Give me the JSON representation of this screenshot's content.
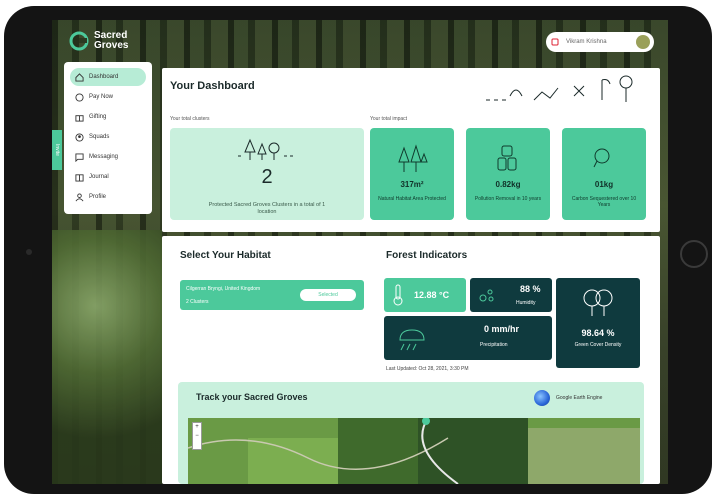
{
  "brand": {
    "name": "Sacred Groves"
  },
  "user": {
    "name": "Vikram Krishna"
  },
  "sidebar": {
    "items": [
      {
        "label": "Dashboard",
        "icon": "home-icon",
        "active": true
      },
      {
        "label": "Pay Now",
        "icon": "coin-icon"
      },
      {
        "label": "Gifting",
        "icon": "gift-icon"
      },
      {
        "label": "Squads",
        "icon": "squad-icon"
      },
      {
        "label": "Messaging",
        "icon": "message-icon"
      },
      {
        "label": "Journal",
        "icon": "journal-icon"
      },
      {
        "label": "Profile",
        "icon": "profile-icon"
      }
    ],
    "side_tab": "Invite"
  },
  "dashboard": {
    "title": "Your Dashboard",
    "clusters_label": "Your total clusters",
    "impact_label": "Your total impact",
    "clusters": {
      "value": "2",
      "description": "Protected Sacred Groves Clusters in a total of 1 location"
    },
    "impact": [
      {
        "value": "317m²",
        "description": "Natural Habitat Area Protected",
        "icon": "trees-icon"
      },
      {
        "value": "0.82kg",
        "description": "Pollution Removal in 10 years",
        "icon": "pollution-icon"
      },
      {
        "value": "01kg",
        "description": "Carbon Sequestered over 10 Years",
        "icon": "carbon-icon"
      }
    ]
  },
  "habitat": {
    "title": "Select Your Habitat",
    "location": "Cilgerran Bryngi, United Kingdom",
    "count": "2 Clusters",
    "button": "Selected"
  },
  "indicators": {
    "title": "Forest Indicators",
    "temperature": "12.88 °C",
    "humidity_value": "88 %",
    "humidity_label": "Humidity",
    "precipitation_value": "0 mm/hr",
    "precipitation_label": "Precipitation",
    "green_cover_value": "98.64 %",
    "green_cover_label": "Green Cover Density",
    "updated": "Last Updated: Oct 28, 2021, 3:30 PM"
  },
  "track": {
    "title": "Track your Sacred Groves",
    "engine": "Google Earth Engine",
    "zoom_in": "+",
    "zoom_out": "−"
  },
  "colors": {
    "accent": "#4cc99b",
    "light": "#c9f0dd",
    "dark": "#0f3a3e"
  }
}
